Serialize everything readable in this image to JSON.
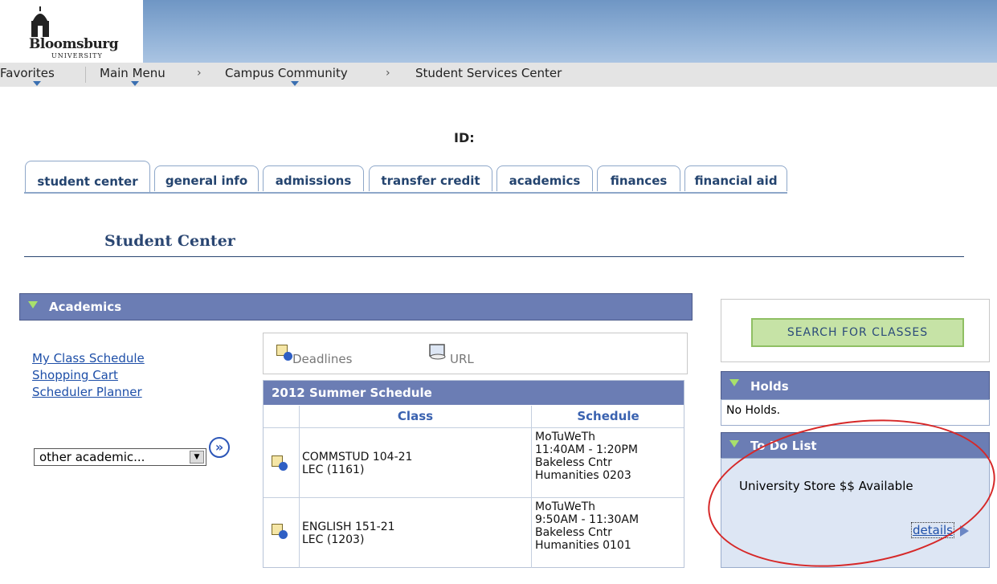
{
  "logo": {
    "name": "Bloomsburg",
    "sub": "UNIVERSITY"
  },
  "nav": {
    "favorites": "Favorites",
    "main_menu": "Main Menu",
    "campus_community": "Campus Community",
    "current": "Student Services Center",
    "separator": "›"
  },
  "id_label": "ID:",
  "tabs": [
    "student center",
    "general info",
    "admissions",
    "transfer credit",
    "academics",
    "finances",
    "financial aid"
  ],
  "page_title": "Student Center",
  "academics": {
    "header": "Academics",
    "links": [
      "My Class Schedule",
      "Shopping Cart",
      "Scheduler Planner"
    ],
    "select_value": "other academic...",
    "select_arrow": "▼",
    "go_symbol": "»"
  },
  "deadlines": {
    "deadlines_label": "Deadlines",
    "url_label": "URL"
  },
  "schedule": {
    "title": "2012 Summer Schedule",
    "columns": [
      "Class",
      "Schedule"
    ],
    "rows": [
      {
        "class": "COMMSTUD 104-21\nLEC (1161)",
        "schedule": "MoTuWeTh\n11:40AM - 1:20PM\nBakeless Cntr\nHumanities 0203"
      },
      {
        "class": "ENGLISH 151-21\nLEC (1203)",
        "schedule": "MoTuWeTh\n9:50AM - 11:30AM\nBakeless Cntr\nHumanities 0101"
      }
    ]
  },
  "search_button": "SEARCH FOR CLASSES",
  "holds": {
    "header": "Holds",
    "body": "No Holds."
  },
  "todo": {
    "header": "To Do List",
    "item": "University Store $$ Available",
    "details": "details"
  },
  "colors": {
    "section_header": "#6b7db4",
    "link": "#1e4fa8",
    "annotation": "#d62828",
    "search_btn": "#c6e3a6"
  }
}
